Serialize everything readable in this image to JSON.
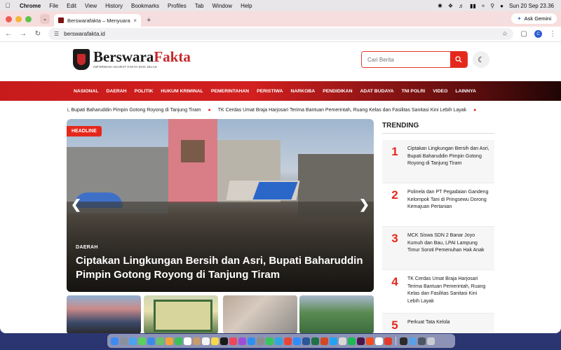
{
  "menubar": {
    "app": "Chrome",
    "items": [
      "File",
      "Edit",
      "View",
      "History",
      "Bookmarks",
      "Profiles",
      "Tab",
      "Window",
      "Help"
    ],
    "datetime": "Sun 20 Sep  23.36"
  },
  "browser": {
    "tab_title": "Berswarafakta – Menyuarakan",
    "url": "berswarafakta.id",
    "ask_gemini": "Ask Gemini",
    "profile_initial": "C"
  },
  "site": {
    "brand_main": "Berswara",
    "brand_accent": "Fakta",
    "tagline": "INFORMASI AKURAT FAKTA DAN JELAS",
    "search_placeholder": "Cari Berita",
    "nav": [
      "NASIONAL",
      "DAERAH",
      "POLITIK",
      "HUKUM KRIMINAL",
      "PEMERINTAHAN",
      "PERISTIWA",
      "NARKOBA",
      "PENDIDIKAN",
      "ADAT BUDAYA",
      "TNI POLRI",
      "VIDEO",
      "LAINNYA"
    ],
    "ticker": [
      "i, Bupati Baharuddin Pimpin Gotong Royong di Tanjung Tiram",
      "TK Cerdas Umat Braja Harjosari Terima Bantuan Pemerintah, Ruang Kelas dan Fasilitas Sanitasi Kini Lebih Layak"
    ],
    "headline": {
      "badge": "HEADLINE",
      "category": "DAERAH",
      "title": "Ciptakan Lingkungan Bersih dan Asri, Bupati Baharuddin Pimpin Gotong Royong di Tanjung Tiram"
    },
    "trending": {
      "title": "TRENDING",
      "items": [
        {
          "num": "1",
          "text": "Ciptakan Lingkungan Bersih dan Asri, Bupati Baharuddin Pimpin Gotong Royong di Tanjung Tiram"
        },
        {
          "num": "2",
          "text": "Polinela dan PT Pegadaian Gandeng Kelompok Tani di Pringsewu Dorong Kemajuan Pertanian"
        },
        {
          "num": "3",
          "text": "MCK Siswa SDN 2 Banar Joyo Kumuh dan Bau, LPAI Lampung Timur Soroti Pemenuhan Hak Anak"
        },
        {
          "num": "4",
          "text": "TK Cerdas Umat Braja Harjosari Terima Bantuan Pemerintah, Ruang Kelas dan Fasilitas Sanitasi Kini Lebih Layak"
        },
        {
          "num": "5",
          "text": "Perkuat Tata Kelola"
        }
      ]
    }
  },
  "colors": {
    "accent": "#e5281c",
    "nav_red": "#c71b1b",
    "tab_strip": "#f6dede"
  }
}
